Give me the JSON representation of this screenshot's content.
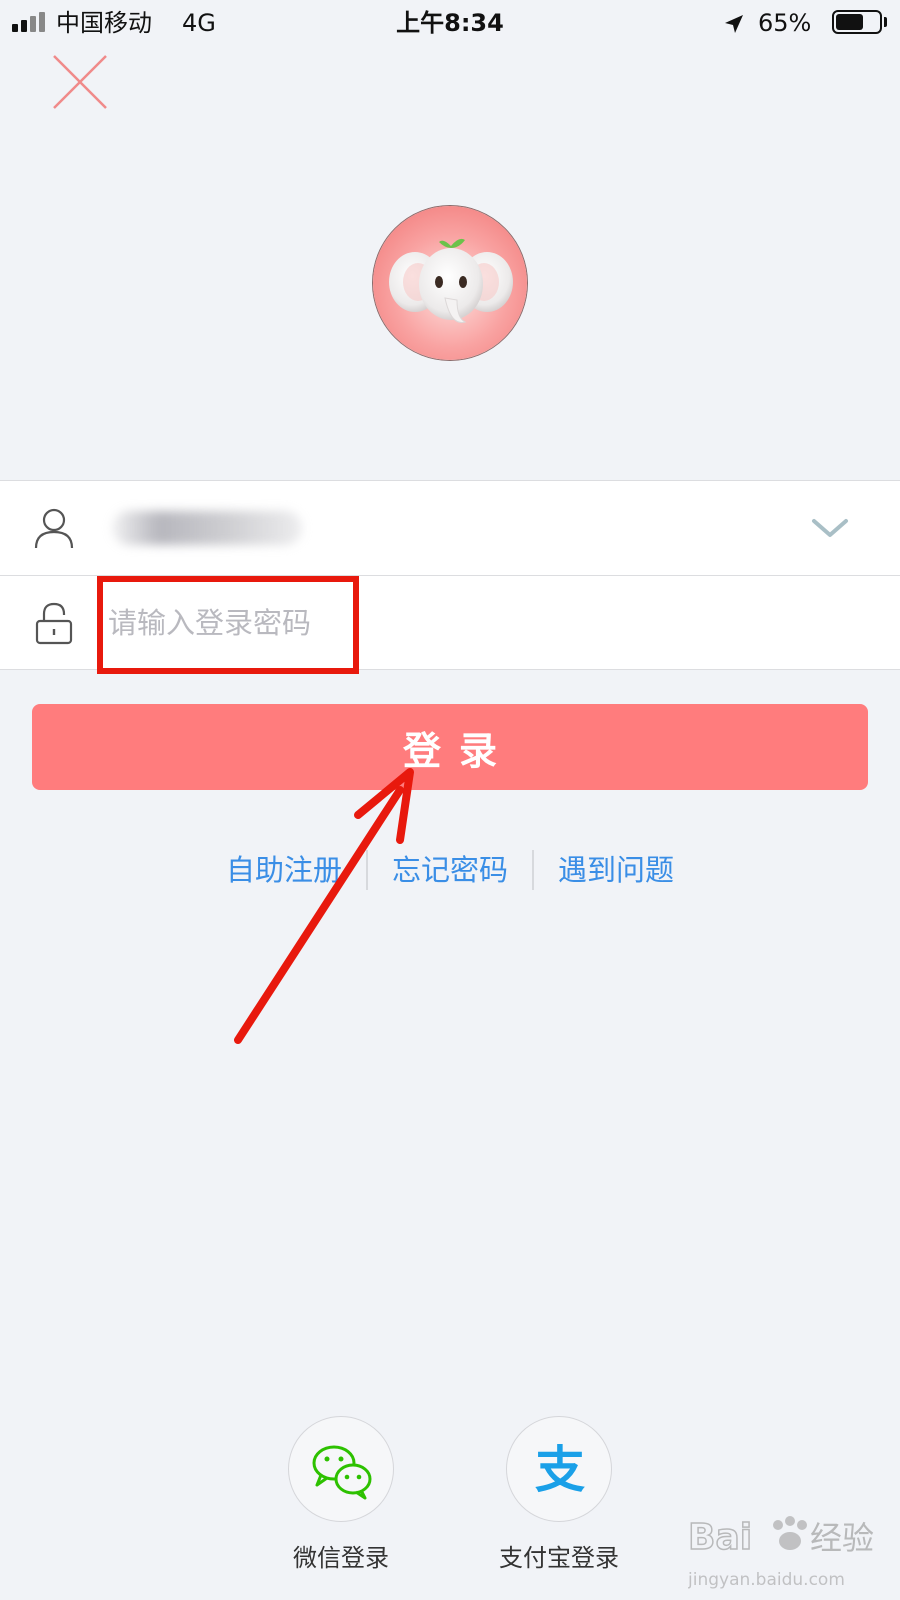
{
  "status_bar": {
    "carrier": "中国移动",
    "network": "4G",
    "time": "上午8:34",
    "battery_percent_text": "65%",
    "battery_level": 0.65
  },
  "icons": {
    "close": "close-icon",
    "user": "user-icon",
    "lock": "lock-icon",
    "dropdown": "chevron-down-icon",
    "wechat": "wechat-icon",
    "alipay": "alipay-icon",
    "location": "location-arrow-icon"
  },
  "form": {
    "username_value": "••••••••",
    "password_placeholder": "请输入登录密码",
    "login_label": "登录"
  },
  "links": {
    "register": "自助注册",
    "forgot": "忘记密码",
    "help": "遇到问题"
  },
  "third_party": {
    "wechat_label": "微信登录",
    "alipay_label": "支付宝登录",
    "alipay_glyph": "支"
  },
  "watermark": {
    "brand": "Bai",
    "sub": "经验",
    "url": "jingyan.baidu.com"
  },
  "colors": {
    "accent": "#ff7c7d",
    "link": "#3a8ee6",
    "highlight": "#e8190d",
    "wechat": "#2dc100",
    "alipay": "#1aa0e8"
  }
}
